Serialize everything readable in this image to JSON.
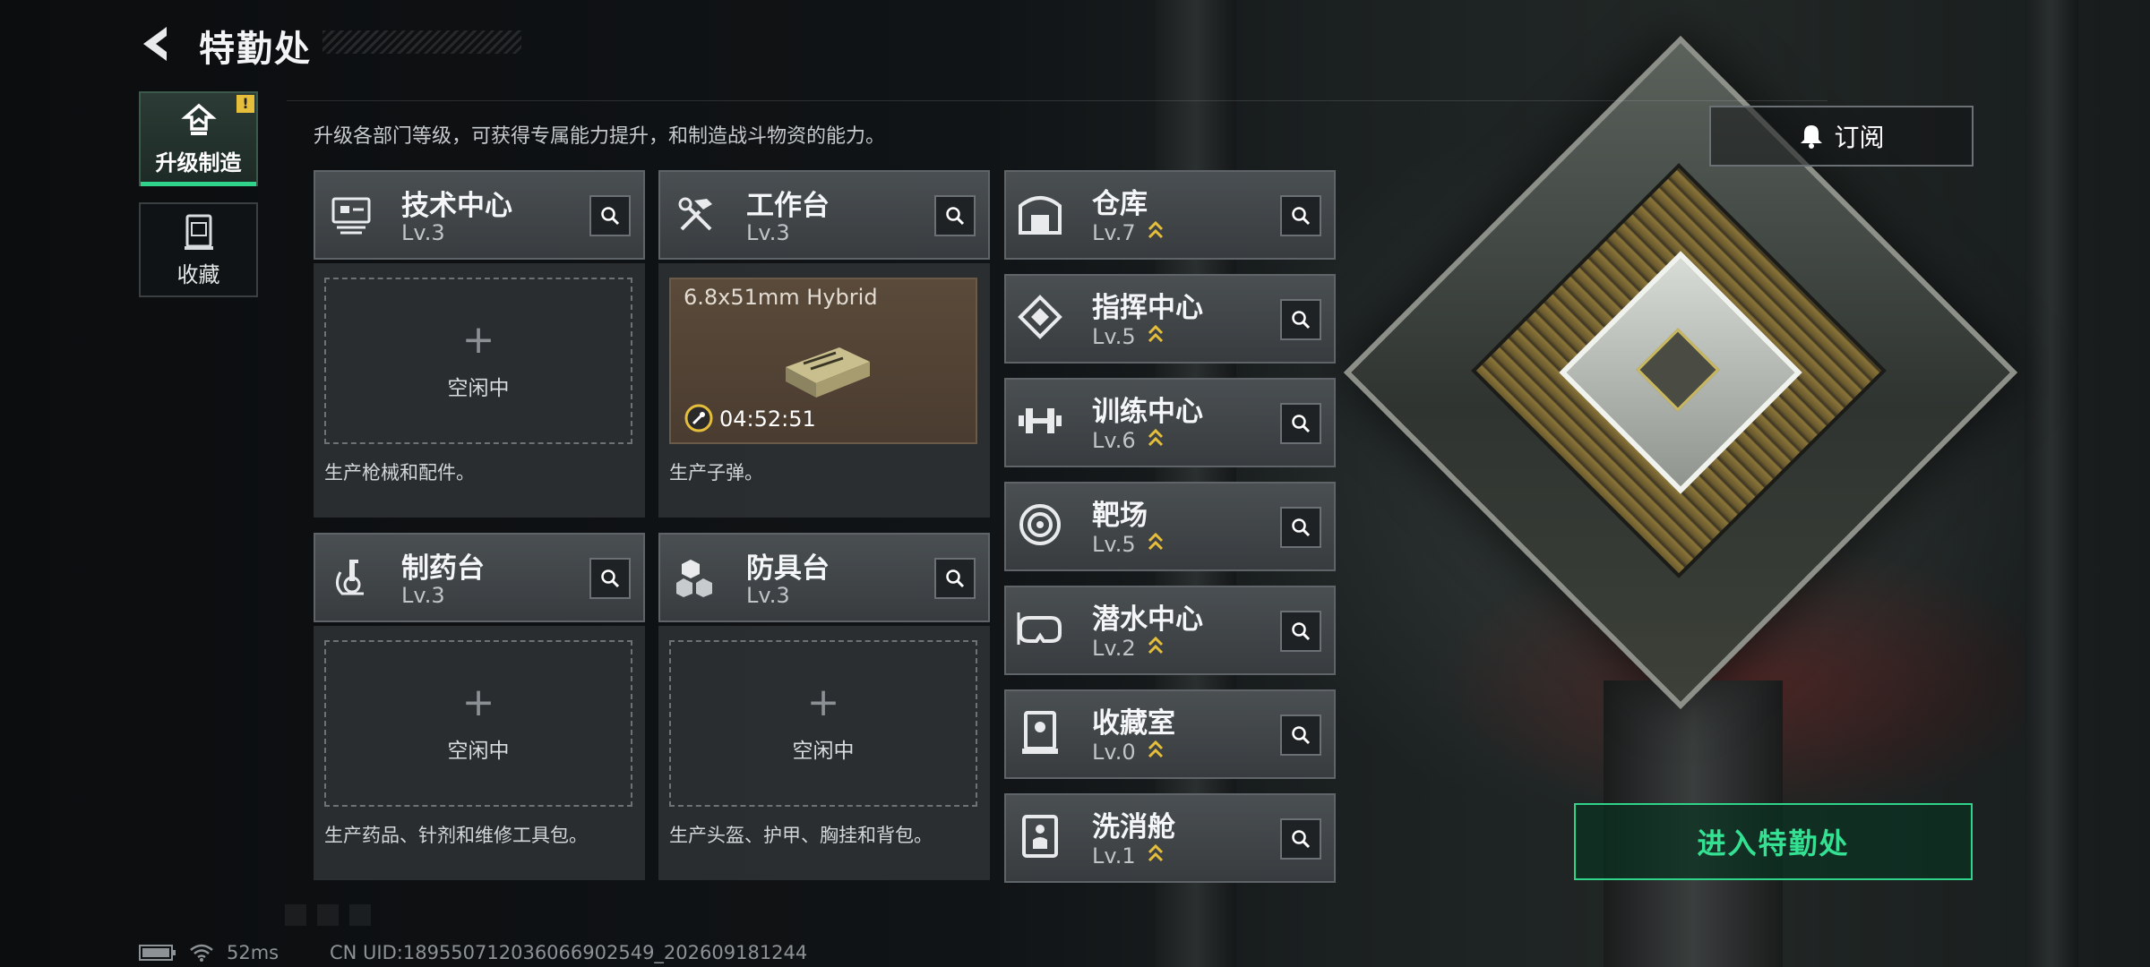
{
  "header": {
    "title": "特勤处"
  },
  "tabs": [
    {
      "label": "升级制造",
      "active": true,
      "badge": "!"
    },
    {
      "label": "收藏",
      "active": false
    }
  ],
  "description": "升级各部门等级，可获得专属能力提升，和制造战斗物资的能力。",
  "workshops": [
    {
      "name": "技术中心",
      "level": "Lv.3",
      "icon": "tech-center-icon",
      "status": "空闲中",
      "desc": "生产枪械和配件。"
    },
    {
      "name": "工作台",
      "level": "Lv.3",
      "icon": "workbench-icon",
      "production": {
        "item": "6.8x51mm Hybrid",
        "timer": "04:52:51",
        "icon": "ammo-box-icon"
      },
      "desc": "生产子弹。"
    },
    {
      "name": "制药台",
      "level": "Lv.3",
      "icon": "pharmacy-icon",
      "status": "空闲中",
      "desc": "生产药品、针剂和维修工具包。"
    },
    {
      "name": "防具台",
      "level": "Lv.3",
      "icon": "armor-bench-icon",
      "status": "空闲中",
      "desc": "生产头盔、护甲、胸挂和背包。"
    }
  ],
  "facilities": [
    {
      "name": "仓库",
      "level": "Lv.7",
      "icon": "warehouse-icon"
    },
    {
      "name": "指挥中心",
      "level": "Lv.5",
      "icon": "command-center-icon"
    },
    {
      "name": "训练中心",
      "level": "Lv.6",
      "icon": "dumbbell-icon"
    },
    {
      "name": "靶场",
      "level": "Lv.5",
      "icon": "target-icon"
    },
    {
      "name": "潜水中心",
      "level": "Lv.2",
      "icon": "diving-mask-icon"
    },
    {
      "name": "收藏室",
      "level": "Lv.0",
      "icon": "collection-case-icon"
    },
    {
      "name": "洗消舱",
      "level": "Lv.1",
      "icon": "decon-chamber-icon"
    }
  ],
  "buttons": {
    "subscribe": "订阅",
    "enter": "进入特勤处"
  },
  "status_bar": {
    "ping": "52ms",
    "uid": "CN UID:1895507120360669025​49_202609181244"
  },
  "colors": {
    "accent": "#2fd38a",
    "upgrade_chevron": "#e5bf3c",
    "badge": "#e5bf3c"
  }
}
